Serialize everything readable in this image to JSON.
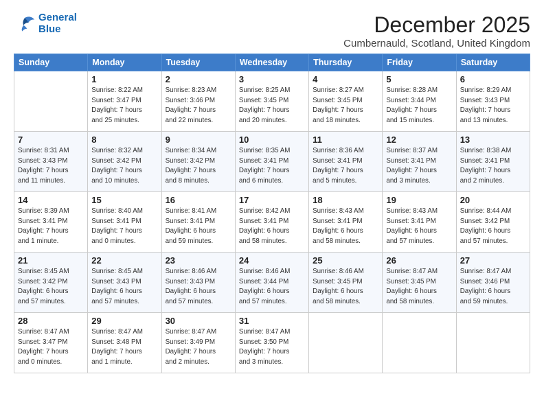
{
  "logo": {
    "line1": "General",
    "line2": "Blue"
  },
  "title": "December 2025",
  "subtitle": "Cumbernauld, Scotland, United Kingdom",
  "days_header": [
    "Sunday",
    "Monday",
    "Tuesday",
    "Wednesday",
    "Thursday",
    "Friday",
    "Saturday"
  ],
  "weeks": [
    [
      {
        "day": "",
        "info": ""
      },
      {
        "day": "1",
        "info": "Sunrise: 8:22 AM\nSunset: 3:47 PM\nDaylight: 7 hours\nand 25 minutes."
      },
      {
        "day": "2",
        "info": "Sunrise: 8:23 AM\nSunset: 3:46 PM\nDaylight: 7 hours\nand 22 minutes."
      },
      {
        "day": "3",
        "info": "Sunrise: 8:25 AM\nSunset: 3:45 PM\nDaylight: 7 hours\nand 20 minutes."
      },
      {
        "day": "4",
        "info": "Sunrise: 8:27 AM\nSunset: 3:45 PM\nDaylight: 7 hours\nand 18 minutes."
      },
      {
        "day": "5",
        "info": "Sunrise: 8:28 AM\nSunset: 3:44 PM\nDaylight: 7 hours\nand 15 minutes."
      },
      {
        "day": "6",
        "info": "Sunrise: 8:29 AM\nSunset: 3:43 PM\nDaylight: 7 hours\nand 13 minutes."
      }
    ],
    [
      {
        "day": "7",
        "info": "Sunrise: 8:31 AM\nSunset: 3:43 PM\nDaylight: 7 hours\nand 11 minutes."
      },
      {
        "day": "8",
        "info": "Sunrise: 8:32 AM\nSunset: 3:42 PM\nDaylight: 7 hours\nand 10 minutes."
      },
      {
        "day": "9",
        "info": "Sunrise: 8:34 AM\nSunset: 3:42 PM\nDaylight: 7 hours\nand 8 minutes."
      },
      {
        "day": "10",
        "info": "Sunrise: 8:35 AM\nSunset: 3:41 PM\nDaylight: 7 hours\nand 6 minutes."
      },
      {
        "day": "11",
        "info": "Sunrise: 8:36 AM\nSunset: 3:41 PM\nDaylight: 7 hours\nand 5 minutes."
      },
      {
        "day": "12",
        "info": "Sunrise: 8:37 AM\nSunset: 3:41 PM\nDaylight: 7 hours\nand 3 minutes."
      },
      {
        "day": "13",
        "info": "Sunrise: 8:38 AM\nSunset: 3:41 PM\nDaylight: 7 hours\nand 2 minutes."
      }
    ],
    [
      {
        "day": "14",
        "info": "Sunrise: 8:39 AM\nSunset: 3:41 PM\nDaylight: 7 hours\nand 1 minute."
      },
      {
        "day": "15",
        "info": "Sunrise: 8:40 AM\nSunset: 3:41 PM\nDaylight: 7 hours\nand 0 minutes."
      },
      {
        "day": "16",
        "info": "Sunrise: 8:41 AM\nSunset: 3:41 PM\nDaylight: 6 hours\nand 59 minutes."
      },
      {
        "day": "17",
        "info": "Sunrise: 8:42 AM\nSunset: 3:41 PM\nDaylight: 6 hours\nand 58 minutes."
      },
      {
        "day": "18",
        "info": "Sunrise: 8:43 AM\nSunset: 3:41 PM\nDaylight: 6 hours\nand 58 minutes."
      },
      {
        "day": "19",
        "info": "Sunrise: 8:43 AM\nSunset: 3:41 PM\nDaylight: 6 hours\nand 57 minutes."
      },
      {
        "day": "20",
        "info": "Sunrise: 8:44 AM\nSunset: 3:42 PM\nDaylight: 6 hours\nand 57 minutes."
      }
    ],
    [
      {
        "day": "21",
        "info": "Sunrise: 8:45 AM\nSunset: 3:42 PM\nDaylight: 6 hours\nand 57 minutes."
      },
      {
        "day": "22",
        "info": "Sunrise: 8:45 AM\nSunset: 3:43 PM\nDaylight: 6 hours\nand 57 minutes."
      },
      {
        "day": "23",
        "info": "Sunrise: 8:46 AM\nSunset: 3:43 PM\nDaylight: 6 hours\nand 57 minutes."
      },
      {
        "day": "24",
        "info": "Sunrise: 8:46 AM\nSunset: 3:44 PM\nDaylight: 6 hours\nand 57 minutes."
      },
      {
        "day": "25",
        "info": "Sunrise: 8:46 AM\nSunset: 3:45 PM\nDaylight: 6 hours\nand 58 minutes."
      },
      {
        "day": "26",
        "info": "Sunrise: 8:47 AM\nSunset: 3:45 PM\nDaylight: 6 hours\nand 58 minutes."
      },
      {
        "day": "27",
        "info": "Sunrise: 8:47 AM\nSunset: 3:46 PM\nDaylight: 6 hours\nand 59 minutes."
      }
    ],
    [
      {
        "day": "28",
        "info": "Sunrise: 8:47 AM\nSunset: 3:47 PM\nDaylight: 7 hours\nand 0 minutes."
      },
      {
        "day": "29",
        "info": "Sunrise: 8:47 AM\nSunset: 3:48 PM\nDaylight: 7 hours\nand 1 minute."
      },
      {
        "day": "30",
        "info": "Sunrise: 8:47 AM\nSunset: 3:49 PM\nDaylight: 7 hours\nand 2 minutes."
      },
      {
        "day": "31",
        "info": "Sunrise: 8:47 AM\nSunset: 3:50 PM\nDaylight: 7 hours\nand 3 minutes."
      },
      {
        "day": "",
        "info": ""
      },
      {
        "day": "",
        "info": ""
      },
      {
        "day": "",
        "info": ""
      }
    ]
  ]
}
